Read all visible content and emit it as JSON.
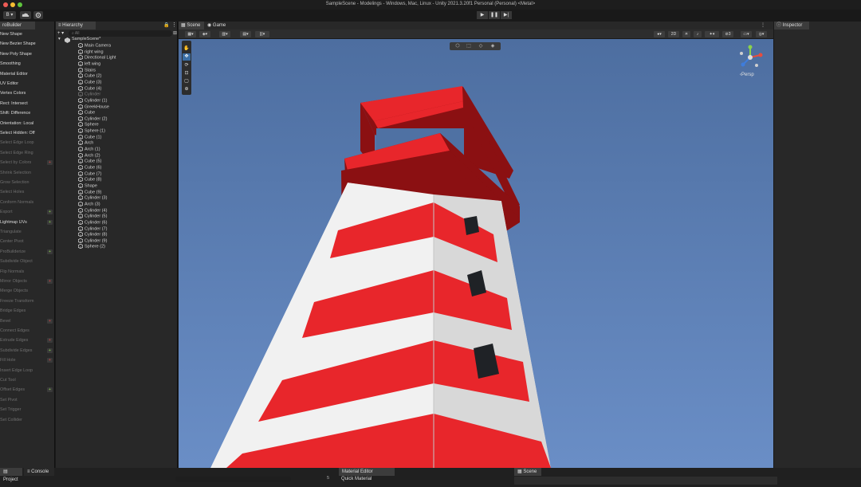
{
  "window": {
    "title": "SampleScene - Modelings - Windows, Mac, Linux - Unity 2021.3.20f1 Personal (Personal) <Metal>"
  },
  "toolbar": {
    "account_label": "B ▾",
    "play": "▶",
    "pause": "❚❚",
    "step": "▶|"
  },
  "probuilder": {
    "tab_label": "roBuilder",
    "items": [
      {
        "label": "New Shape",
        "enabled": true,
        "option": ""
      },
      {
        "label": "New Bezier Shape",
        "enabled": true,
        "option": ""
      },
      {
        "label": "New Poly Shape",
        "enabled": true,
        "option": ""
      },
      {
        "label": "Smoothing",
        "enabled": true,
        "option": ""
      },
      {
        "label": "Material Editor",
        "enabled": true,
        "option": ""
      },
      {
        "label": "UV Editor",
        "enabled": true,
        "option": ""
      },
      {
        "label": "Vertex Colors",
        "enabled": true,
        "option": ""
      },
      {
        "label": "Rect: Intersect",
        "enabled": true,
        "option": ""
      },
      {
        "label": "Shift: Difference",
        "enabled": true,
        "option": ""
      },
      {
        "label": "Orientation: Local",
        "enabled": true,
        "option": ""
      },
      {
        "label": "Select Hidden: Off",
        "enabled": true,
        "option": ""
      },
      {
        "label": "Select Edge Loop",
        "enabled": false,
        "option": ""
      },
      {
        "label": "Select Edge Ring",
        "enabled": false,
        "option": ""
      },
      {
        "label": "Select by Colors",
        "enabled": false,
        "option": "+"
      },
      {
        "label": "Shrink Selection",
        "enabled": false,
        "option": ""
      },
      {
        "label": "Grow Selection",
        "enabled": false,
        "option": ""
      },
      {
        "label": "Select Holes",
        "enabled": false,
        "option": ""
      },
      {
        "label": "Conform Normals",
        "enabled": false,
        "option": ""
      },
      {
        "label": "Export",
        "enabled": false,
        "option": "+"
      },
      {
        "label": "Lightmap UVs",
        "enabled": true,
        "option": "+"
      },
      {
        "label": "Triangulate",
        "enabled": false,
        "option": ""
      },
      {
        "label": "Center Pivot",
        "enabled": false,
        "option": ""
      },
      {
        "label": "ProBuilderize",
        "enabled": false,
        "option": "+"
      },
      {
        "label": "Subdivide Object",
        "enabled": false,
        "option": ""
      },
      {
        "label": "Flip Normals",
        "enabled": false,
        "option": ""
      },
      {
        "label": "Mirror Objects",
        "enabled": false,
        "option": "+"
      },
      {
        "label": "Merge Objects",
        "enabled": false,
        "option": ""
      },
      {
        "label": "Freeze Transform",
        "enabled": false,
        "option": ""
      },
      {
        "label": "Bridge Edges",
        "enabled": false,
        "option": ""
      },
      {
        "label": "Bevel",
        "enabled": false,
        "option": "+"
      },
      {
        "label": "Connect Edges",
        "enabled": false,
        "option": ""
      },
      {
        "label": "Extrude Edges",
        "enabled": false,
        "option": "+"
      },
      {
        "label": "Subdivide Edges",
        "enabled": false,
        "option": "+"
      },
      {
        "label": "Fill Hole",
        "enabled": false,
        "option": "+"
      },
      {
        "label": "Insert Edge Loop",
        "enabled": false,
        "option": ""
      },
      {
        "label": "Cut Tool",
        "enabled": false,
        "option": ""
      },
      {
        "label": "Offset Edges",
        "enabled": false,
        "option": "+"
      },
      {
        "label": "Set Pivot",
        "enabled": false,
        "option": ""
      },
      {
        "label": "Set Trigger",
        "enabled": false,
        "option": ""
      },
      {
        "label": "Set Collider",
        "enabled": false,
        "option": ""
      }
    ]
  },
  "hierarchy": {
    "tab_label": "Hierarchy",
    "add_label": "+ ▾",
    "search_placeholder": "All",
    "scene_name": "SampleScene*",
    "items": [
      {
        "label": "Main Camera",
        "dim": false
      },
      {
        "label": "right wing",
        "dim": false
      },
      {
        "label": "Directional Light",
        "dim": false
      },
      {
        "label": "left wing",
        "dim": false
      },
      {
        "label": "Stairs",
        "dim": false
      },
      {
        "label": "Cube (2)",
        "dim": false
      },
      {
        "label": "Cube (3)",
        "dim": false
      },
      {
        "label": "Cube (4)",
        "dim": false
      },
      {
        "label": "Cylinder",
        "dim": true
      },
      {
        "label": "Cylinder (1)",
        "dim": false
      },
      {
        "label": "GreekHouse",
        "dim": false
      },
      {
        "label": "Cube",
        "dim": false
      },
      {
        "label": "Cylinder (2)",
        "dim": false
      },
      {
        "label": "Sphere",
        "dim": false
      },
      {
        "label": "Sphere (1)",
        "dim": false
      },
      {
        "label": "Cube (1)",
        "dim": false
      },
      {
        "label": "Arch",
        "dim": false
      },
      {
        "label": "Arch (1)",
        "dim": false
      },
      {
        "label": "Arch (2)",
        "dim": false
      },
      {
        "label": "Cube (5)",
        "dim": false
      },
      {
        "label": "Cube (6)",
        "dim": false
      },
      {
        "label": "Cube (7)",
        "dim": false
      },
      {
        "label": "Cube (8)",
        "dim": false
      },
      {
        "label": "Shape",
        "dim": false
      },
      {
        "label": "Cube (9)",
        "dim": false
      },
      {
        "label": "Cylinder (3)",
        "dim": false
      },
      {
        "label": "Arch (3)",
        "dim": false
      },
      {
        "label": "Cylinder (4)",
        "dim": false
      },
      {
        "label": "Cylinder (5)",
        "dim": false
      },
      {
        "label": "Cylinder (6)",
        "dim": false
      },
      {
        "label": "Cylinder (7)",
        "dim": false
      },
      {
        "label": "Cylinder (8)",
        "dim": false
      },
      {
        "label": "Cylinder (9)",
        "dim": false
      },
      {
        "label": "Sphere (2)",
        "dim": false
      }
    ]
  },
  "scene": {
    "tabs": [
      "Scene",
      "Game"
    ],
    "active_tab": "Scene",
    "mode_2d": "2D",
    "persp_label": "‹Persp",
    "colors": {
      "sky_top": "#4d6ea0",
      "sky_bottom": "#6a8ec6",
      "red": "#e8262b",
      "red_dark": "#8b1012",
      "white": "#f1f1f1",
      "white_side": "#d8d8d8",
      "window": "#1f2226"
    }
  },
  "inspector": {
    "tab_label": "Inspector"
  },
  "bottom": {
    "tabs": [
      "Project",
      "Console"
    ],
    "material_editor": "Material Editor",
    "quick_material": "Quick Material",
    "scene_tab": "Scene",
    "badge": "5"
  }
}
